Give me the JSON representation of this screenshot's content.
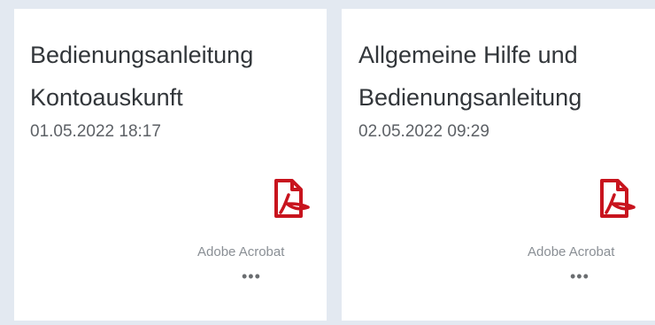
{
  "tiles": [
    {
      "title_line1": "Bedienungsanleitung",
      "title_line2": "Kontoauskunft",
      "date": "01.05.2022 18:17",
      "icon": "pdf-file-icon",
      "app_label": "Adobe Acrobat",
      "more_label": "•••"
    },
    {
      "title_line1": "Allgemeine Hilfe und",
      "title_line2": "Bedienungsanleitung",
      "date": "02.05.2022 09:29",
      "icon": "pdf-file-icon",
      "app_label": "Adobe Acrobat",
      "more_label": "•••"
    }
  ],
  "colors": {
    "background": "#e3e9f1",
    "tile": "#ffffff",
    "title_text": "#32363a",
    "date_text": "#5d6166",
    "pdf_red": "#c8141e",
    "label_text": "#8a8f95"
  }
}
